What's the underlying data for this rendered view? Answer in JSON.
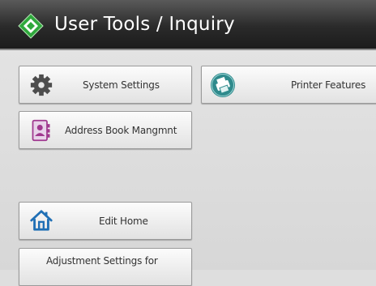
{
  "header": {
    "title": "User Tools / Inquiry",
    "title_icon": "green-diamond-tools-icon",
    "accent": "#3cb44b"
  },
  "buttons": {
    "system_settings": {
      "label": "System Settings",
      "icon": "gear-icon"
    },
    "printer_features": {
      "label": "Printer Features",
      "icon": "printer-icon"
    },
    "address_book": {
      "label": "Address Book Mangmnt",
      "icon": "address-book-icon"
    },
    "edit_home": {
      "label": "Edit Home",
      "icon": "home-icon"
    },
    "adjustment_settings": {
      "label": "Adjustment Settings for"
    }
  }
}
